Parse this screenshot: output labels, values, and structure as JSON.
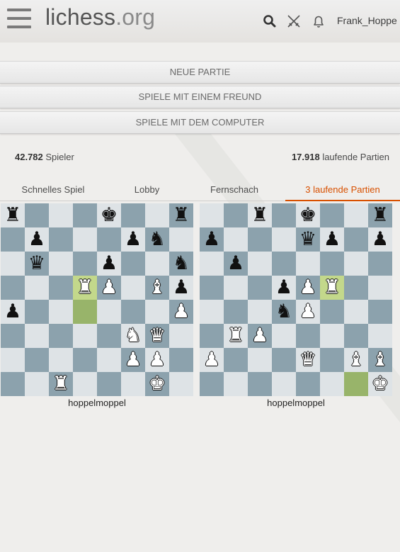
{
  "header": {
    "site_name": "lichess",
    "site_tld": ".org",
    "username": "Frank_Hoppe",
    "icons": [
      "menu-icon",
      "search-icon",
      "crossed-swords-icon",
      "bell-icon"
    ]
  },
  "buttons": {
    "new_game": "Neue Partie",
    "play_friend": "Spiele mit einem Freund",
    "play_computer": "Spiele mit dem Computer"
  },
  "stats": {
    "players_count": "42.782",
    "players_label": " Spieler",
    "games_count": "17.918",
    "games_label": " laufende Partien"
  },
  "tabs": [
    {
      "label": "Schnelles Spiel",
      "active": false
    },
    {
      "label": "Lobby",
      "active": false
    },
    {
      "label": "Fernschach",
      "active": false
    },
    {
      "label": "3 laufende Partien",
      "active": true
    }
  ],
  "colors": {
    "accent": "#d85000",
    "board_light": "#dee3e6",
    "board_dark": "#8ca2ad",
    "highlight": "#c3d88b"
  },
  "games": [
    {
      "player": "hoppelmoppel",
      "ranks": [
        "r...k..r",
        ".p...pn.",
        ".q..p..n",
        "...RP.Bp",
        "p......P",
        ".....NQ.",
        ".....PP.",
        "..R...K."
      ],
      "highlight": [
        "d5",
        "d4"
      ]
    },
    {
      "player": "hoppelmoppel",
      "ranks": [
        "..r.k..r",
        "p...qp.p",
        ".p......",
        "...pPR..",
        "...nP...",
        ".RP.....",
        "P...Q..B",
        ".......K"
      ],
      "highlight": [
        "f5",
        "g1"
      ],
      "extra_pieces": {
        "g2": "B"
      }
    }
  ]
}
